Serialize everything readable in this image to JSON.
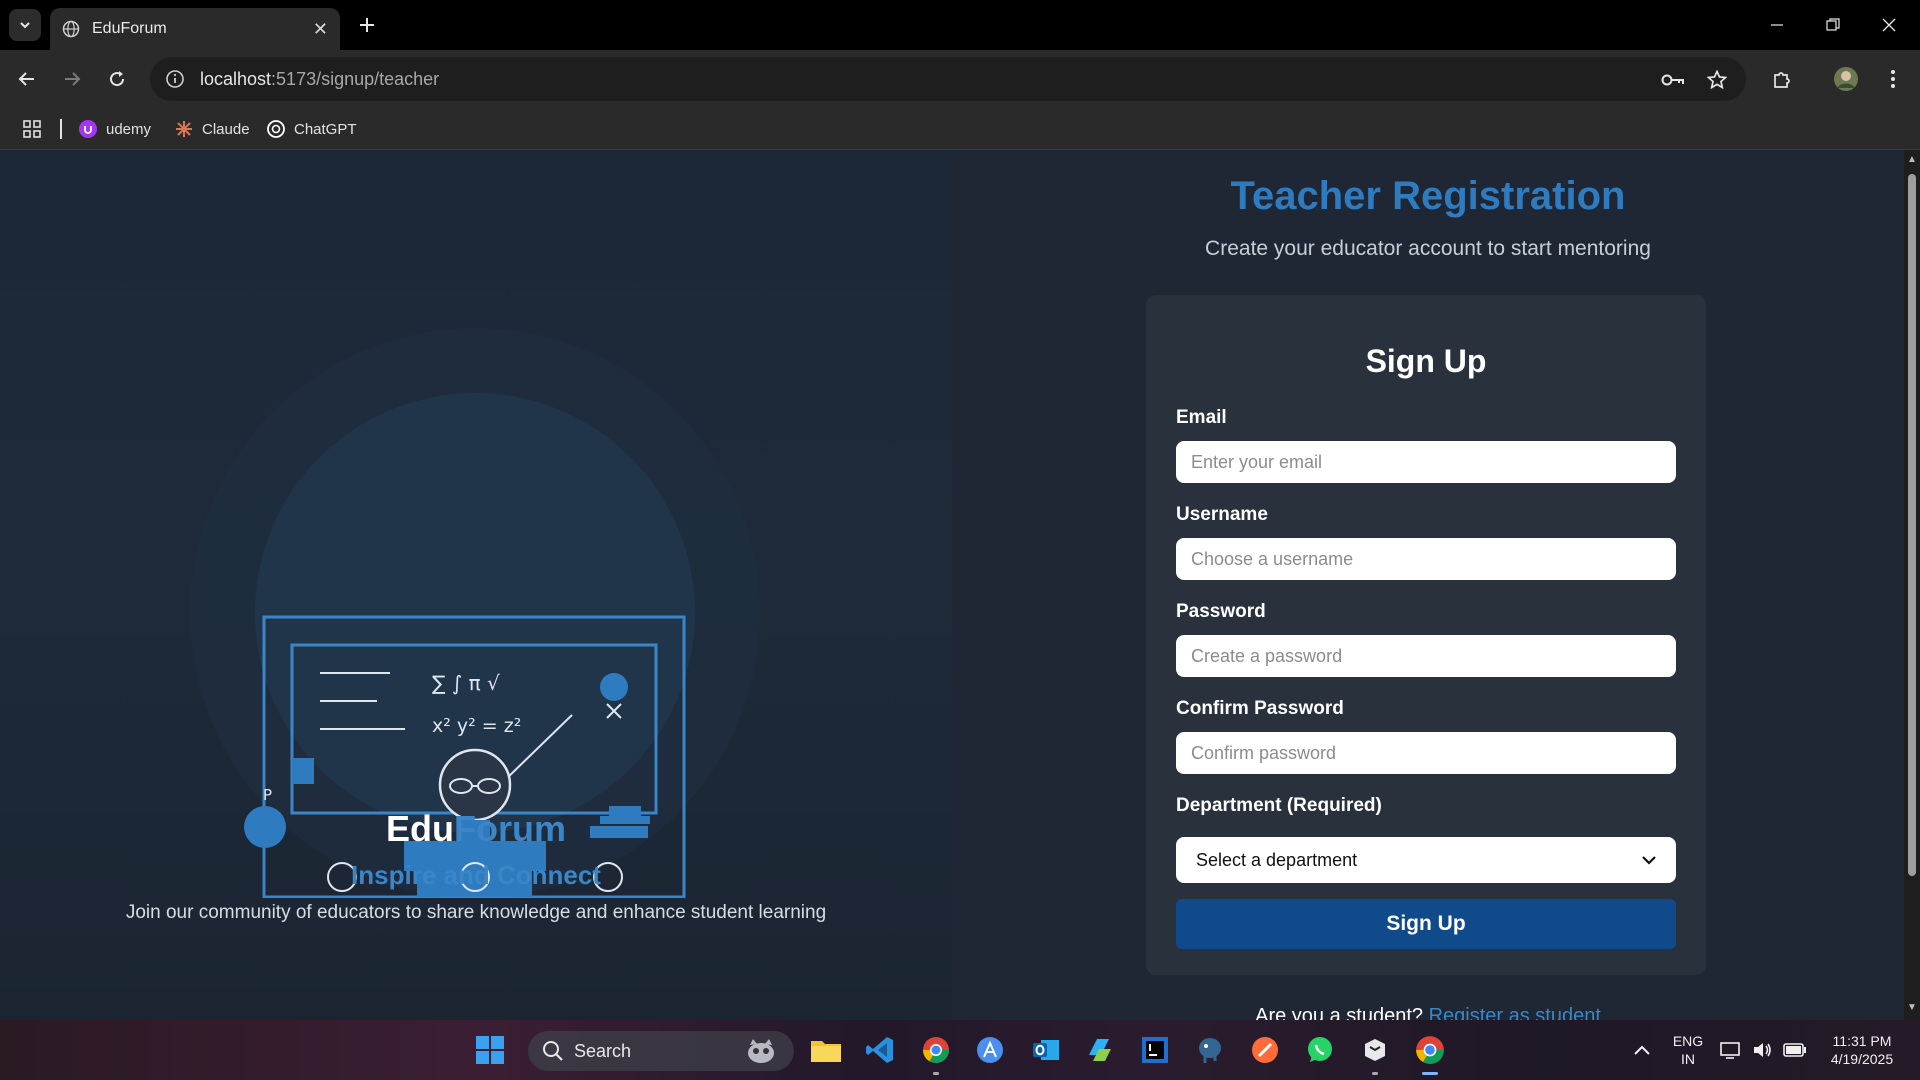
{
  "browser": {
    "tab_title": "EduForum",
    "url_host": "localhost",
    "url_path": ":5173/signup/teacher",
    "bookmarks": [
      {
        "label": "udemy",
        "icon": "udemy-icon",
        "color": "#a435f0"
      },
      {
        "label": "Claude",
        "icon": "claude-icon",
        "color": "#d97757"
      },
      {
        "label": "ChatGPT",
        "icon": "chatgpt-icon",
        "color": "#ffffff"
      }
    ]
  },
  "hero": {
    "brand_part1": "Edu",
    "brand_part2": "Forum",
    "tagline": "Inspire and Connect",
    "blurb": "Join our community of educators to share knowledge and enhance student learning",
    "board_math_line1": "∑ ∫  π  √",
    "board_math_line2": "x²  y²  =  z²",
    "board_p": "P"
  },
  "registration": {
    "title": "Teacher Registration",
    "subtitle": "Create your educator account to start mentoring",
    "card_title": "Sign Up",
    "email_label": "Email",
    "email_placeholder": "Enter your email",
    "username_label": "Username",
    "username_placeholder": "Choose a username",
    "password_label": "Password",
    "password_placeholder": "Create a password",
    "confirm_label": "Confirm Password",
    "confirm_placeholder": "Confirm password",
    "department_label": "Department (Required)",
    "department_selected": "Select a department",
    "submit_label": "Sign Up",
    "student_prompt": "Are you a student?",
    "student_link": "Register as student"
  },
  "taskbar": {
    "search_label": "Search",
    "language_line1": "ENG",
    "language_line2": "IN",
    "time": "11:31 PM",
    "date": "4/19/2025"
  },
  "colors": {
    "accent": "#2f7bc0",
    "button": "#0f4a8a",
    "card": "#29313c"
  }
}
